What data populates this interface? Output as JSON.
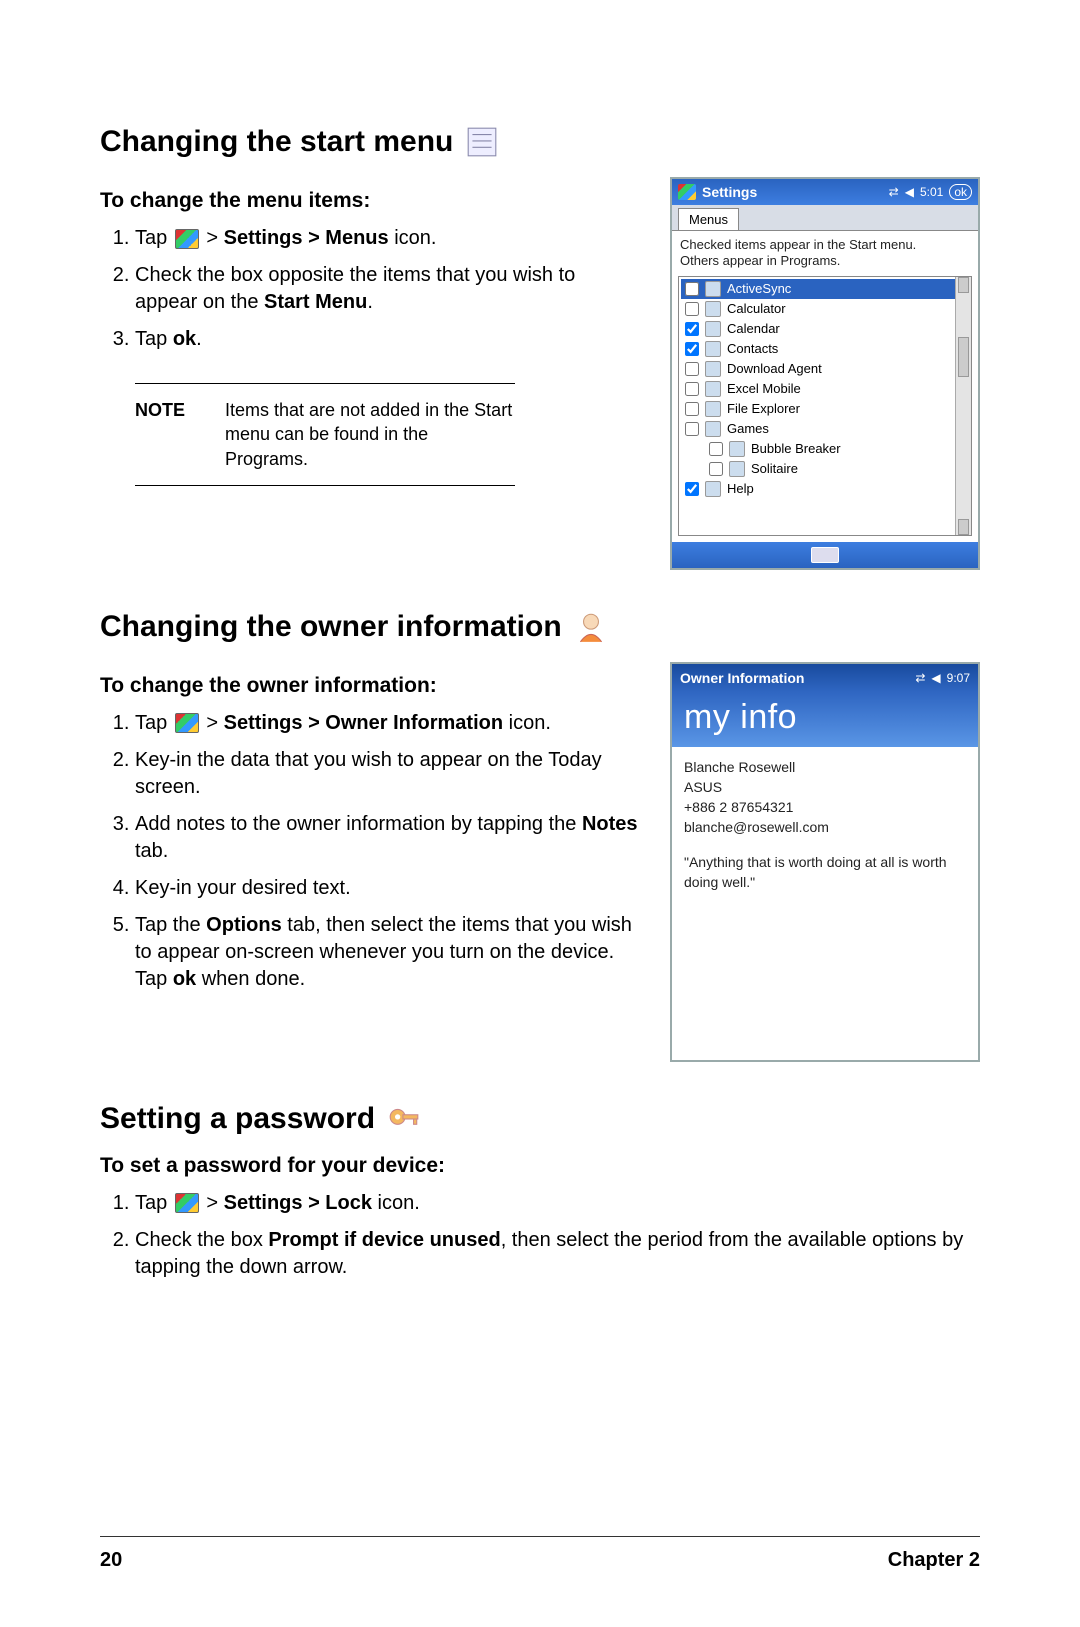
{
  "section1": {
    "heading": "Changing the start menu",
    "sub": "To change the menu items:",
    "steps": {
      "s1a": "Tap ",
      "s1b": " > ",
      "s1c": "Settings > Menus",
      "s1d": " icon.",
      "s2a": "Check the box opposite the items that you wish to appear on the ",
      "s2b": "Start Menu",
      "s2c": ".",
      "s3a": "Tap ",
      "s3b": "ok",
      "s3c": "."
    },
    "note_label": "NOTE",
    "note_text": "Items that are not added in the Start menu can be found in the Programs."
  },
  "device1": {
    "title": "Settings",
    "time": "5:01",
    "ok": "ok",
    "tab": "Menus",
    "helper1": "Checked items appear in the Start menu.",
    "helper2": "Others appear in Programs.",
    "items": [
      {
        "label": "ActiveSync",
        "checked": false,
        "selected": true
      },
      {
        "label": "Calculator",
        "checked": false
      },
      {
        "label": "Calendar",
        "checked": true
      },
      {
        "label": "Contacts",
        "checked": true
      },
      {
        "label": "Download Agent",
        "checked": false
      },
      {
        "label": "Excel Mobile",
        "checked": false
      },
      {
        "label": "File Explorer",
        "checked": false
      },
      {
        "label": "Games",
        "checked": false
      },
      {
        "label": "Bubble Breaker",
        "checked": false,
        "indent": 1
      },
      {
        "label": "Solitaire",
        "checked": false,
        "indent": 1
      },
      {
        "label": "Help",
        "checked": true
      }
    ]
  },
  "section2": {
    "heading": "Changing the owner information",
    "sub": "To change the owner information:",
    "steps": {
      "s1a": "Tap ",
      "s1b": " > ",
      "s1c": "Settings > Owner Information",
      "s1d": " icon.",
      "s2": "Key-in the data that you wish to appear on the Today screen.",
      "s3a": "Add notes to the owner information by tapping the ",
      "s3b": "Notes",
      "s3c": " tab.",
      "s4": "Key-in your desired text.",
      "s5a": "Tap the ",
      "s5b": "Options",
      "s5c": " tab, then select the items that you wish to appear on-screen whenever you turn on the device. Tap ",
      "s5d": "ok",
      "s5e": " when done."
    }
  },
  "device2": {
    "title": "Owner Information",
    "time": "9:07",
    "banner": "my info",
    "name": "Blanche Rosewell",
    "company": "ASUS",
    "phone": "+886 2 87654321",
    "email": "blanche@rosewell.com",
    "quote": "\"Anything that is worth doing at all is worth doing well.\""
  },
  "section3": {
    "heading": "Setting a password",
    "sub": "To set a password for your device:",
    "steps": {
      "s1a": "Tap ",
      "s1b": " > ",
      "s1c": "Settings > Lock",
      "s1d": " icon.",
      "s2a": "Check the box ",
      "s2b": "Prompt if device unused",
      "s2c": ", then select the period from the available options by tapping the down arrow."
    }
  },
  "footer": {
    "page": "20",
    "chapter": "Chapter 2"
  }
}
